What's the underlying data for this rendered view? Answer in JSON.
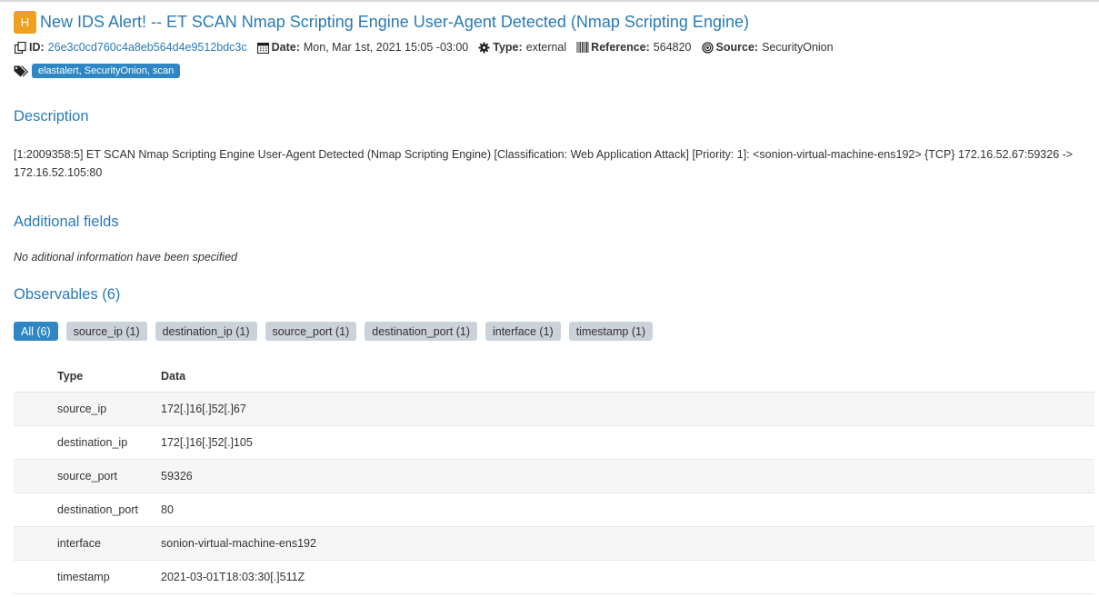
{
  "alert": {
    "severity": "H",
    "title": "New IDS Alert! -- ET SCAN Nmap Scripting Engine User-Agent Detected (Nmap Scripting Engine)"
  },
  "meta": {
    "id_label": "ID:",
    "id_value": "26e3c0cd760c4a8eb564d4e9512bdc3c",
    "date_label": "Date:",
    "date_value": "Mon, Mar 1st, 2021 15:05 -03:00",
    "type_label": "Type:",
    "type_value": "external",
    "reference_label": "Reference:",
    "reference_value": "564820",
    "source_label": "Source:",
    "source_value": "SecurityOnion"
  },
  "tags": "elastalert, SecurityOnion, scan",
  "description": {
    "heading": "Description",
    "text": "[1:2009358:5] ET SCAN Nmap Scripting Engine User-Agent Detected (Nmap Scripting Engine) [Classification: Web Application Attack] [Priority: 1]: <sonion-virtual-machine-ens192> {TCP} 172.16.52.67:59326 -> 172.16.52.105:80"
  },
  "additional": {
    "heading": "Additional fields",
    "empty_text": "No aditional information have been specified"
  },
  "observables": {
    "heading": "Observables (6)",
    "filters": [
      "All (6)",
      "source_ip (1)",
      "destination_ip (1)",
      "source_port (1)",
      "destination_port (1)",
      "interface (1)",
      "timestamp (1)"
    ],
    "col_type": "Type",
    "col_data": "Data",
    "rows": [
      {
        "type": "source_ip",
        "data": "172[.]16[.]52[.]67"
      },
      {
        "type": "destination_ip",
        "data": "172[.]16[.]52[.]105"
      },
      {
        "type": "source_port",
        "data": "59326"
      },
      {
        "type": "destination_port",
        "data": "80"
      },
      {
        "type": "interface",
        "data": "sonion-virtual-machine-ens192"
      },
      {
        "type": "timestamp",
        "data": "2021-03-01T18:03:30[.]511Z"
      }
    ]
  },
  "colors": {
    "link": "#2a7ab8",
    "severity_high": "#f0a020",
    "tag_bg": "#2e87c4",
    "filter_bg": "#ccd2d9"
  }
}
